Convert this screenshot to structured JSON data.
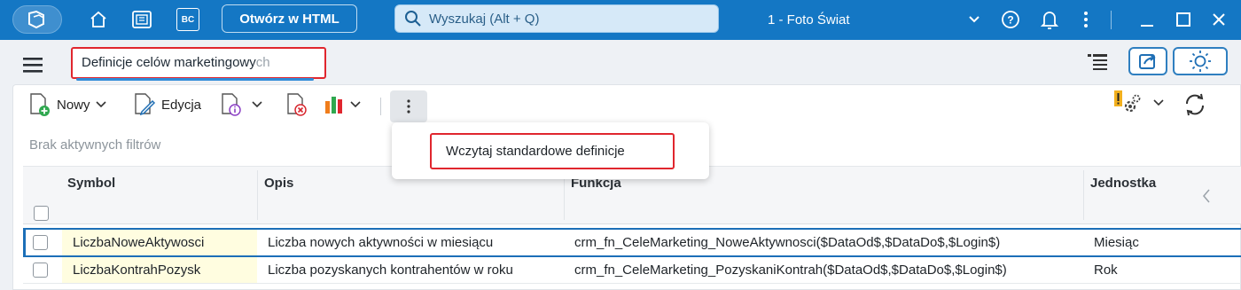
{
  "topbar": {
    "open_html_label": "Otwórz w HTML",
    "bc_label": "BC",
    "search_placeholder": "Wyszukaj (Alt + Q)",
    "company": "1 - Foto Świat"
  },
  "tab": {
    "label_main": "Definicje celów marketingowy",
    "label_fade": "ch"
  },
  "toolbar": {
    "new_label": "Nowy",
    "edit_label": "Edycja"
  },
  "filters_text": "Brak aktywnych filtrów",
  "dropdown": {
    "item": "Wczytaj standardowe definicje"
  },
  "grid": {
    "columns": [
      "Symbol",
      "Opis",
      "Funkcja",
      "Jednostka"
    ],
    "rows": [
      {
        "symbol": "LiczbaNoweAktywosci",
        "opis": "Liczba nowych aktywności w miesiącu",
        "funkcja": "crm_fn_CeleMarketing_NoweAktywnosci($DataOd$,$DataDo$,$Login$)",
        "jednostka": "Miesiąc"
      },
      {
        "symbol": "LiczbaKontrahPozysk",
        "opis": "Liczba pozyskanych kontrahentów w roku",
        "funkcja": "crm_fn_CeleMarketing_PozyskaniKontrah($DataOd$,$DataDo$,$Login$)",
        "jednostka": "Rok"
      }
    ]
  },
  "colors": {
    "titlebar": "#1477c4",
    "highlight_border": "#e0262e",
    "selection": "#1c6fb8",
    "symbol_cell_bg": "#fffde0"
  },
  "icons": [
    "app-logo-icon",
    "home-icon",
    "workspace-icon",
    "help-icon",
    "bell-icon",
    "kebab-icon",
    "minimize-icon",
    "maximize-icon",
    "close-icon",
    "search-icon",
    "hamburger-icon",
    "sidebar-list-icon",
    "share-icon",
    "sun-icon",
    "new-doc-icon",
    "edit-doc-icon",
    "info-doc-icon",
    "delete-doc-icon",
    "chart-icon",
    "settings-alert-icon",
    "refresh-icon"
  ]
}
